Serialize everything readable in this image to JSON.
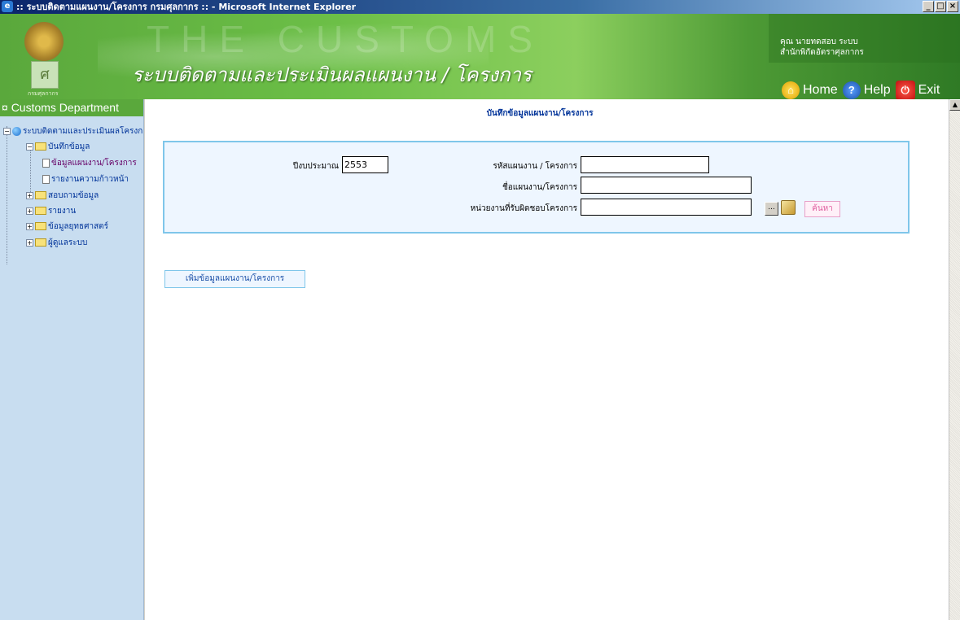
{
  "window": {
    "title": ":: ระบบติดตามแผนงาน/โครงการ กรมศุลกากร :: - Microsoft Internet Explorer",
    "minimize": "_",
    "maximize": "□",
    "close": "×"
  },
  "header": {
    "watermark": "THE CUSTOMS",
    "logo_caption": "กรมศุลกากร",
    "app_title": "ระบบติดตามและประเมินผลแผนงาน / โครงการ",
    "user_name": "คุณ นายทดสอบ ระบบ",
    "user_org": "สำนักพิกัดอัตราศุลกากร",
    "nav": {
      "home": "Home",
      "help": "Help",
      "exit": "Exit"
    }
  },
  "sidebar": {
    "heading": "Customs Department",
    "tree": {
      "root": "ระบบติดตามและประเมินผลโครงการ",
      "record": "บันทึกข้อมูล",
      "plan_data": "ข้อมูลแผนงาน/โครงการ",
      "progress_report": "รายงานความก้าวหน้า",
      "query": "สอบถามข้อมูล",
      "report": "รายงาน",
      "strategy": "ข้อมูลยุทธศาสตร์",
      "admin": "ผู้ดูแลระบบ"
    }
  },
  "main": {
    "page_title": "บันทึกข้อมูลแผนงาน/โครงการ",
    "form": {
      "fiscal_year_label": "ปีงบประมาณ",
      "fiscal_year_value": "2553",
      "plan_code_label": "รหัสแผนงาน / โครงการ",
      "plan_code_value": "",
      "plan_name_label": "ชื่อแผนงาน/โครงการ",
      "plan_name_value": "",
      "unit_label": "หน่วยงานที่รับผิดชอบโครงการ",
      "unit_value": "",
      "browse_label": "...",
      "search_label": "ค้นหา"
    },
    "add_button": "เพิ่มข้อมูลแผนงาน/โครงการ"
  },
  "scrollbar": {
    "up_arrow": "▲"
  }
}
